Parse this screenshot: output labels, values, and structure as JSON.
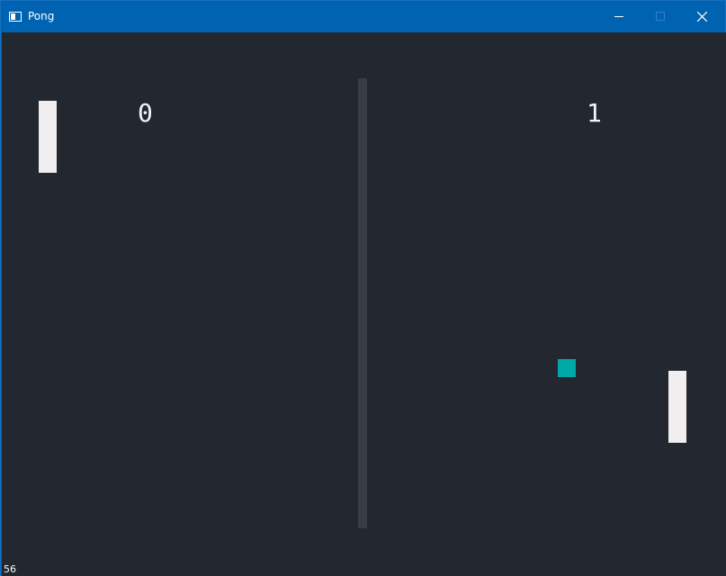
{
  "window": {
    "title": "Pong",
    "icon": "window-app-icon",
    "controls": [
      "minimize-icon",
      "maximize-icon",
      "close-icon"
    ],
    "titlebar_color": "#0063b1"
  },
  "game": {
    "background_color": "#232730",
    "net_color": "#3a3d46",
    "paddle_color": "#f0eeee",
    "ball_color": "#00a8a8",
    "score_left": "0",
    "score_right": "1",
    "fps": "56"
  }
}
